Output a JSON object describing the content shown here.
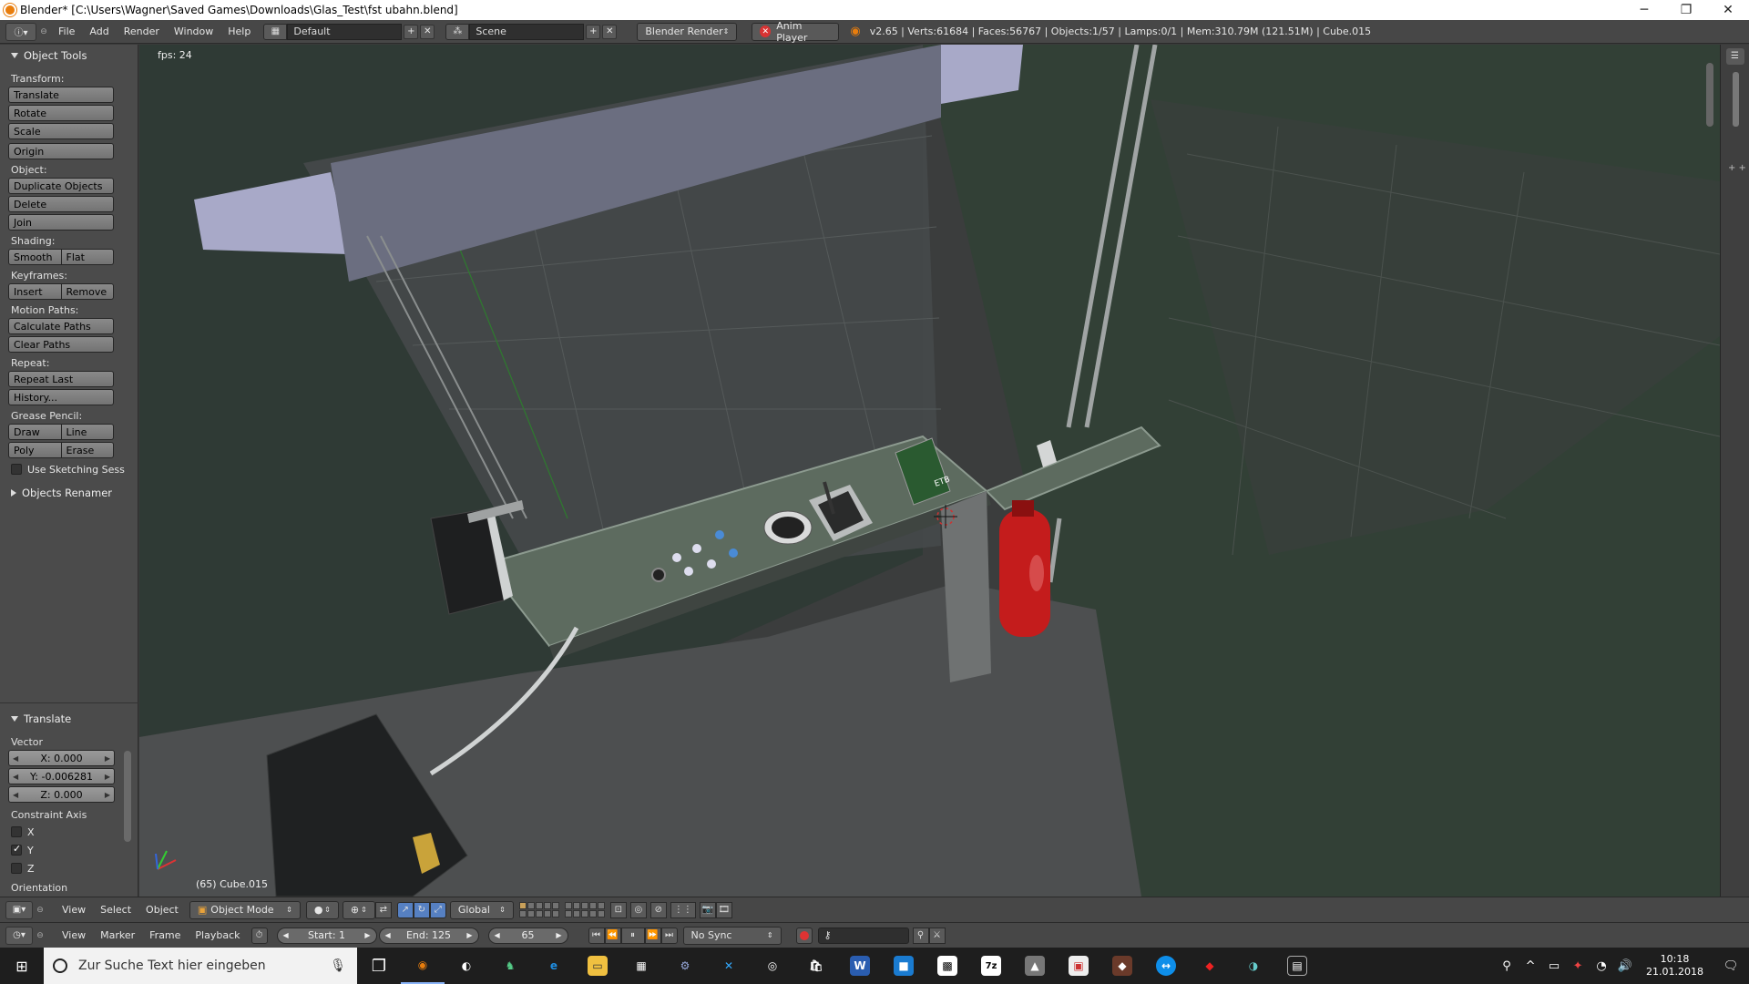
{
  "window": {
    "title": "Blender* [C:\\Users\\Wagner\\Saved Games\\Downloads\\Glas_Test\\fst ubahn.blend]",
    "minimize": "─",
    "maximize": "❐",
    "close": "✕"
  },
  "infobar": {
    "menus": [
      "File",
      "Add",
      "Render",
      "Window",
      "Help"
    ],
    "screen_layout": "Default",
    "scene": "Scene",
    "render_engine": "Blender Render",
    "anim_player": "Anim Player",
    "stats": "v2.65 | Verts:61684 | Faces:56767 | Objects:1/57 | Lamps:0/1 | Mem:310.79M (121.51M) | Cube.015"
  },
  "toolshelf": {
    "header": "Object Tools",
    "sections": {
      "transform_label": "Transform:",
      "translate": "Translate",
      "rotate": "Rotate",
      "scale": "Scale",
      "origin": "Origin",
      "object_label": "Object:",
      "duplicate": "Duplicate Objects",
      "delete": "Delete",
      "join": "Join",
      "shading_label": "Shading:",
      "smooth": "Smooth",
      "flat": "Flat",
      "keyframes_label": "Keyframes:",
      "insert": "Insert",
      "remove": "Remove",
      "motion_label": "Motion Paths:",
      "calc_paths": "Calculate Paths",
      "clear_paths": "Clear Paths",
      "repeat_label": "Repeat:",
      "repeat_last": "Repeat Last",
      "history": "History...",
      "grease_label": "Grease Pencil:",
      "draw": "Draw",
      "line": "Line",
      "poly": "Poly",
      "erase": "Erase",
      "sketching": "Use Sketching Sess",
      "renamer": "Objects Renamer"
    },
    "operator": {
      "header": "Translate",
      "vector_label": "Vector",
      "x": "X: 0.000",
      "y": "Y: -0.006281",
      "z": "Z: 0.000",
      "constraint_label": "Constraint Axis",
      "cx": "X",
      "cy": "Y",
      "cz": "Z",
      "orientation_label": "Orientation"
    }
  },
  "viewport": {
    "fps": "fps: 24",
    "object_info": "(65) Cube.015",
    "sign_text": "ETB"
  },
  "view_header": {
    "menus": [
      "View",
      "Select",
      "Object"
    ],
    "mode": "Object Mode",
    "orientation": "Global"
  },
  "timeline": {
    "menus": [
      "View",
      "Marker",
      "Frame",
      "Playback"
    ],
    "start": "Start: 1",
    "end": "End: 125",
    "current": "65",
    "sync": "No Sync"
  },
  "taskbar": {
    "search_placeholder": "Zur Suche Text hier eingeben",
    "time": "10:18",
    "date": "21.01.2018"
  },
  "colors": {
    "accent": "#e87d0d",
    "extinguisher": "#c41c1c",
    "desk": "#5d6b5f"
  }
}
